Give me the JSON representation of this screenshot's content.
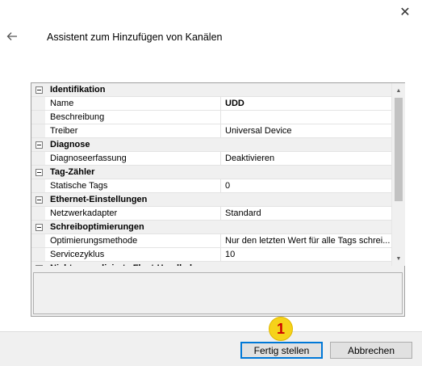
{
  "window": {
    "close_glyph": "✕",
    "title": "Assistent zum Hinzufügen von Kanälen"
  },
  "grid": {
    "rows": [
      {
        "type": "category",
        "label": "Identifikation"
      },
      {
        "type": "property",
        "name": "Name",
        "value": "UDD",
        "bold": true
      },
      {
        "type": "property",
        "name": "Beschreibung",
        "value": ""
      },
      {
        "type": "property",
        "name": "Treiber",
        "value": "Universal Device"
      },
      {
        "type": "category",
        "label": "Diagnose"
      },
      {
        "type": "property",
        "name": "Diagnoseerfassung",
        "value": "Deaktivieren"
      },
      {
        "type": "category",
        "label": "Tag-Zähler"
      },
      {
        "type": "property",
        "name": "Statische Tags",
        "value": "0"
      },
      {
        "type": "category",
        "label": "Ethernet-Einstellungen"
      },
      {
        "type": "property",
        "name": "Netzwerkadapter",
        "value": "Standard"
      },
      {
        "type": "category",
        "label": "Schreiboptimierungen"
      },
      {
        "type": "property",
        "name": "Optimierungsmethode",
        "value": "Nur den letzten Wert für alle Tags schrei..."
      },
      {
        "type": "property",
        "name": "Servicezyklus",
        "value": "10"
      },
      {
        "type": "category",
        "label": "Nicht normalisierte Float-Handhabung"
      }
    ],
    "scroll_up": "▲",
    "scroll_down": "▼",
    "description": ""
  },
  "footer": {
    "finish_label": "Fertig stellen",
    "cancel_label": "Abbrechen"
  },
  "annotation": {
    "marker_number": "1"
  }
}
